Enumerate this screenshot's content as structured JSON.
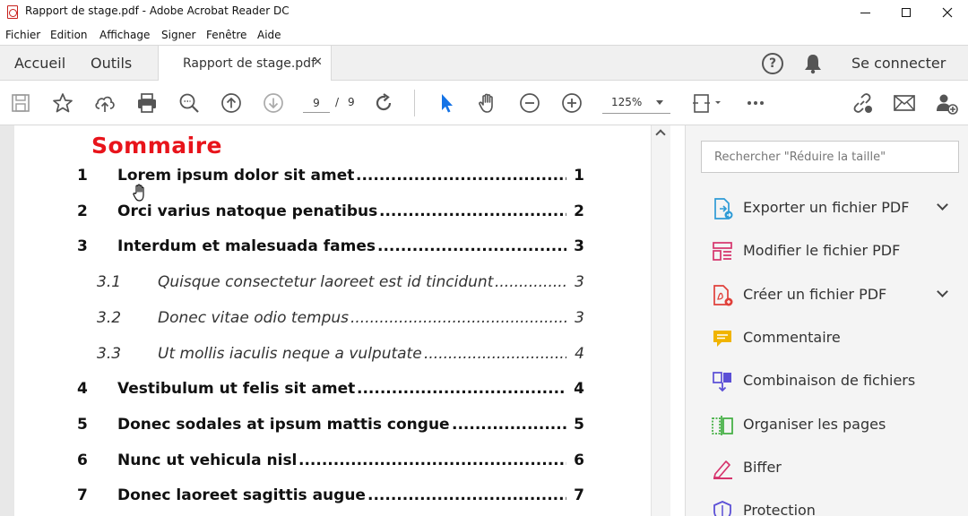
{
  "window": {
    "title": "Rapport de stage.pdf - Adobe Acrobat Reader DC"
  },
  "menu": [
    "Fichier",
    "Edition",
    "Affichage",
    "Signer",
    "Fenêtre",
    "Aide"
  ],
  "tabs": {
    "home": "Accueil",
    "tools": "Outils",
    "document": "Rapport de stage.pdf",
    "close_glyph": "✕"
  },
  "header": {
    "help_glyph": "?",
    "sign_in": "Se connecter"
  },
  "toolbar": {
    "current_page": "9",
    "page_separator": "/",
    "total_pages": "9",
    "zoom": "125%",
    "icons": [
      "save-icon",
      "bookmark-star-icon",
      "upload-cloud-icon",
      "print-icon",
      "search-zoom-icon",
      "page-up-icon",
      "page-down-icon",
      "rotate-icon",
      "select-cursor-icon",
      "hand-tool-icon",
      "zoom-out-icon",
      "zoom-in-icon",
      "fit-page-icon",
      "more-icon",
      "link-icon",
      "mail-icon",
      "add-user-icon"
    ]
  },
  "document": {
    "toc_title": "Sommaire",
    "entries": [
      {
        "num": "1",
        "label": "Lorem ipsum dolor sit amet",
        "page": "1",
        "level": 1
      },
      {
        "num": "2",
        "label": "Orci varius natoque penatibus",
        "page": "2",
        "level": 1
      },
      {
        "num": "3",
        "label": "Interdum et malesuada fames",
        "page": "3",
        "level": 1
      },
      {
        "num": "3.1",
        "label": "Quisque consectetur laoreet est id tincidunt",
        "page": "3",
        "level": 2
      },
      {
        "num": "3.2",
        "label": "Donec vitae odio tempus",
        "page": "3",
        "level": 2
      },
      {
        "num": "3.3",
        "label": "Ut mollis iaculis neque a vulputate",
        "page": "4",
        "level": 2
      },
      {
        "num": "4",
        "label": "Vestibulum ut felis sit amet",
        "page": "4",
        "level": 1
      },
      {
        "num": "5",
        "label": "Donec sodales at ipsum mattis congue",
        "page": "5",
        "level": 1
      },
      {
        "num": "6",
        "label": "Nunc ut vehicula nisl",
        "page": "6",
        "level": 1
      },
      {
        "num": "7",
        "label": "Donec laoreet sagittis augue",
        "page": "7",
        "level": 1
      }
    ]
  },
  "tools_panel": {
    "search_placeholder": "Rechercher \"Réduire la taille\"",
    "items": [
      {
        "label": "Exporter un fichier PDF",
        "icon": "export-pdf-icon",
        "color": "#2e9bd6",
        "expand": true
      },
      {
        "label": "Modifier le fichier PDF",
        "icon": "edit-pdf-icon",
        "color": "#d6336c",
        "expand": false
      },
      {
        "label": "Créer un fichier PDF",
        "icon": "create-pdf-icon",
        "color": "#e0403a",
        "expand": true
      },
      {
        "label": "Commentaire",
        "icon": "comment-icon",
        "color": "#f0b400",
        "expand": false
      },
      {
        "label": "Combinaison de fichiers",
        "icon": "combine-files-icon",
        "color": "#5b4fd6",
        "expand": false
      },
      {
        "label": "Organiser les pages",
        "icon": "organize-pages-icon",
        "color": "#3fae3f",
        "expand": false
      },
      {
        "label": "Biffer",
        "icon": "redact-icon",
        "color": "#d6336c",
        "expand": false
      },
      {
        "label": "Protection",
        "icon": "protect-icon",
        "color": "#5b4fd6",
        "expand": false
      }
    ]
  },
  "colors": {
    "accent_blue": "#1473e6",
    "toc_title_red": "#e8141b"
  }
}
